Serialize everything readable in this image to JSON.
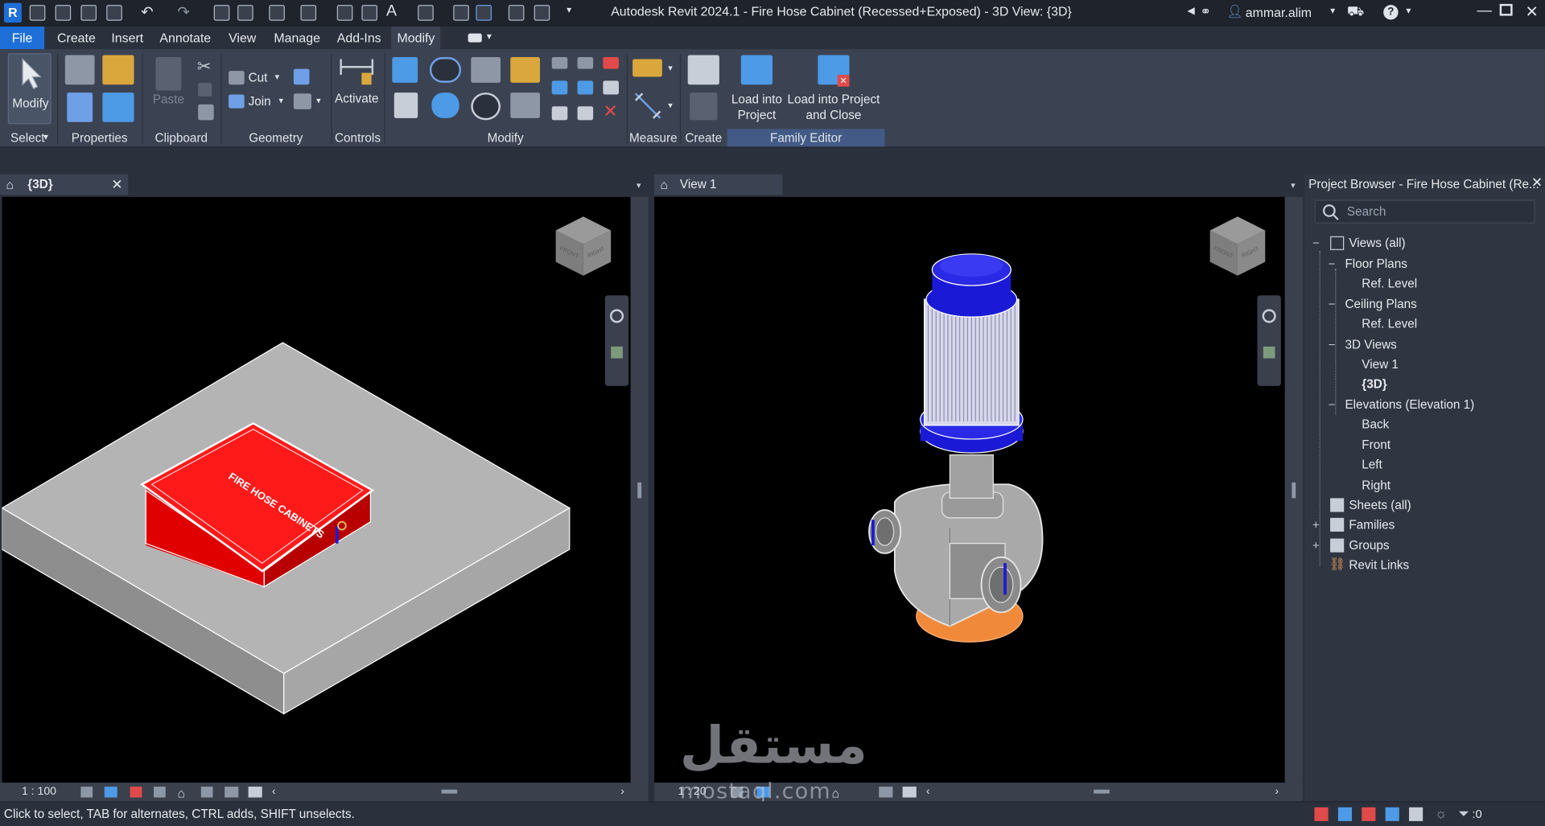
{
  "window": {
    "title": "Autodesk Revit 2024.1 - Fire Hose Cabinet (Recessed+Exposed) - 3D View: {3D}",
    "user": "ammar.alim",
    "logo": "R"
  },
  "menu": {
    "items": [
      "File",
      "Create",
      "Insert",
      "Annotate",
      "View",
      "Manage",
      "Add-Ins",
      "Modify"
    ],
    "active": "Modify"
  },
  "ribbon": {
    "select": {
      "modify_label": "Modify",
      "panel": "Select"
    },
    "properties": {
      "panel": "Properties"
    },
    "clipboard": {
      "paste": "Paste",
      "panel": "Clipboard"
    },
    "geometry": {
      "cut": "Cut",
      "join": "Join",
      "panel": "Geometry"
    },
    "controls": {
      "activate": "Activate",
      "panel": "Controls"
    },
    "modify": {
      "panel": "Modify"
    },
    "measure": {
      "panel": "Measure"
    },
    "create": {
      "panel": "Create"
    },
    "family_editor": {
      "load_into_project": "Load into Project",
      "load_into_project_close": "Load into Project and Close",
      "panel": "Family Editor"
    }
  },
  "views": {
    "left": {
      "tab": "{3D}",
      "scale": "1 : 100",
      "model_text": "FIRE HOSE CABINETS"
    },
    "right": {
      "tab": "View 1",
      "scale": "1 : 20"
    },
    "viewcube": {
      "front": "FRONT",
      "right": "RIGHT"
    }
  },
  "browser": {
    "title": "Project Browser - Fire Hose Cabinet (Re...",
    "search_placeholder": "Search",
    "nodes": {
      "views_all": "Views (all)",
      "floor_plans": "Floor Plans",
      "fp_ref": "Ref. Level",
      "ceiling_plans": "Ceiling Plans",
      "cp_ref": "Ref. Level",
      "views_3d": "3D Views",
      "view1": "View 1",
      "view_3d": "{3D}",
      "elevations": "Elevations (Elevation 1)",
      "back": "Back",
      "front": "Front",
      "left": "Left",
      "right": "Right",
      "sheets": "Sheets (all)",
      "families": "Families",
      "groups": "Groups",
      "revit_links": "Revit Links"
    }
  },
  "status": {
    "hint": "Click to select, TAB for alternates, CTRL adds, SHIFT unselects.",
    "filter_count": ":0"
  },
  "watermark": {
    "arabic": "مستقل",
    "latin": "mostaql.com"
  },
  "colors": {
    "accent": "#1e6fd8",
    "cabinet_red": "#ff1a1a",
    "slab_grey": "#b4b4b4",
    "motor_blue": "#1a1ad6"
  }
}
